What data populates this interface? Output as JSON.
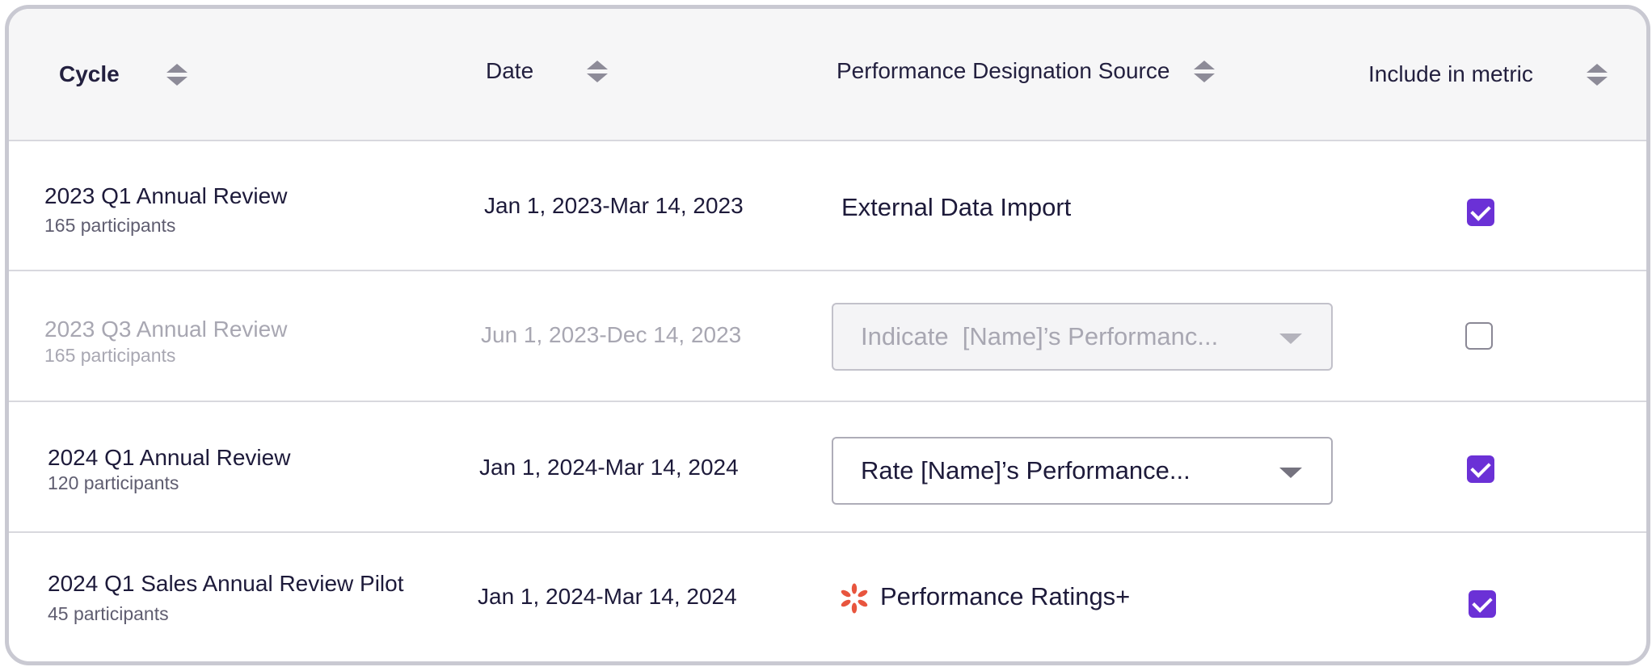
{
  "columns": {
    "cycle": "Cycle",
    "date": "Date",
    "source": "Performance Designation Source",
    "include": "Include in metric"
  },
  "rows": [
    {
      "cycle": "2023 Q1 Annual Review",
      "participants": "165 participants",
      "date": "Jan 1, 2023-Mar 14, 2023",
      "source_text": "External Data Import",
      "include": true
    },
    {
      "cycle": "2023 Q3 Annual Review",
      "participants": "165 participants",
      "date": "Jun 1, 2023-Dec 14, 2023",
      "source_dropdown": "Indicate  [Name]’s Performanc...",
      "dropdown_disabled": true,
      "include": false
    },
    {
      "cycle": "2024 Q1 Annual Review",
      "participants": "120 participants",
      "date": "Jan 1, 2024-Mar 14, 2024",
      "source_dropdown": "Rate [Name]’s Performance...",
      "dropdown_disabled": false,
      "include": true
    },
    {
      "cycle": "2024 Q1 Sales Annual Review Pilot",
      "participants": "45 participants",
      "date": "Jan 1, 2024-Mar 14, 2024",
      "source_text": "Performance Ratings+",
      "source_icon": "performance-ratings-logo-icon",
      "include": true
    }
  ],
  "colors": {
    "checkbox_accent": "#6b31d6",
    "logo_accent": "#e8553e",
    "header_bg": "#f6f6f7"
  }
}
